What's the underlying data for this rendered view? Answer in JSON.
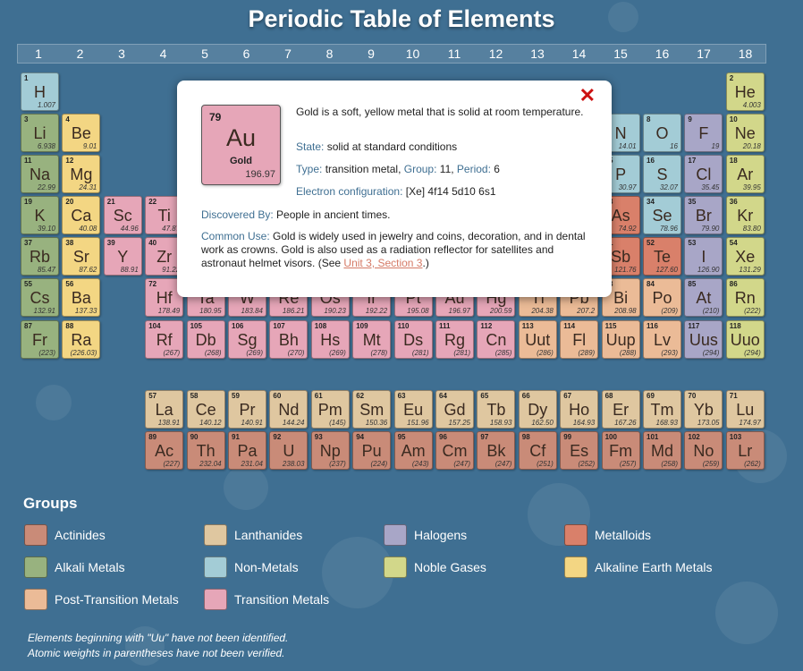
{
  "title": "Periodic Table of Elements",
  "group_numbers": [
    "1",
    "2",
    "3",
    "4",
    "5",
    "6",
    "7",
    "8",
    "9",
    "10",
    "11",
    "12",
    "13",
    "14",
    "15",
    "16",
    "17",
    "18"
  ],
  "category_colors": {
    "actinide": "#c98b78",
    "lanthanide": "#dfc7a0",
    "halogen": "#a8a6c7",
    "metalloid": "#d9806a",
    "alkali": "#98b27f",
    "nonmetal": "#a3ccd6",
    "noble": "#d2d78a",
    "alkearth": "#f3d683",
    "posttrans": "#ebbb97",
    "trans": "#e6a6b8"
  },
  "elements": [
    {
      "n": "1",
      "s": "H",
      "w": "1.007",
      "cat": "nonmetal",
      "period": 1,
      "group": 1
    },
    {
      "n": "2",
      "s": "He",
      "w": "4.003",
      "cat": "noble",
      "period": 1,
      "group": 18
    },
    {
      "n": "3",
      "s": "Li",
      "w": "6.938",
      "cat": "alkali",
      "period": 2,
      "group": 1
    },
    {
      "n": "4",
      "s": "Be",
      "w": "9.01",
      "cat": "alkearth",
      "period": 2,
      "group": 2
    },
    {
      "n": "7",
      "s": "N",
      "w": "14.01",
      "cat": "nonmetal",
      "period": 2,
      "group": 15
    },
    {
      "n": "8",
      "s": "O",
      "w": "16",
      "cat": "nonmetal",
      "period": 2,
      "group": 16
    },
    {
      "n": "9",
      "s": "F",
      "w": "19",
      "cat": "halogen",
      "period": 2,
      "group": 17
    },
    {
      "n": "10",
      "s": "Ne",
      "w": "20.18",
      "cat": "noble",
      "period": 2,
      "group": 18
    },
    {
      "n": "11",
      "s": "Na",
      "w": "22.99",
      "cat": "alkali",
      "period": 3,
      "group": 1
    },
    {
      "n": "12",
      "s": "Mg",
      "w": "24.31",
      "cat": "alkearth",
      "period": 3,
      "group": 2
    },
    {
      "n": "15",
      "s": "P",
      "w": "30.97",
      "cat": "nonmetal",
      "period": 3,
      "group": 15
    },
    {
      "n": "16",
      "s": "S",
      "w": "32.07",
      "cat": "nonmetal",
      "period": 3,
      "group": 16
    },
    {
      "n": "17",
      "s": "Cl",
      "w": "35.45",
      "cat": "halogen",
      "period": 3,
      "group": 17
    },
    {
      "n": "18",
      "s": "Ar",
      "w": "39.95",
      "cat": "noble",
      "period": 3,
      "group": 18
    },
    {
      "n": "19",
      "s": "K",
      "w": "39.10",
      "cat": "alkali",
      "period": 4,
      "group": 1
    },
    {
      "n": "20",
      "s": "Ca",
      "w": "40.08",
      "cat": "alkearth",
      "period": 4,
      "group": 2
    },
    {
      "n": "21",
      "s": "Sc",
      "w": "44.96",
      "cat": "trans",
      "period": 4,
      "group": 3
    },
    {
      "n": "22",
      "s": "Ti",
      "w": "47.87",
      "cat": "trans",
      "period": 4,
      "group": 4
    },
    {
      "n": "33",
      "s": "As",
      "w": "74.92",
      "cat": "metalloid",
      "period": 4,
      "group": 15
    },
    {
      "n": "34",
      "s": "Se",
      "w": "78.96",
      "cat": "nonmetal",
      "period": 4,
      "group": 16
    },
    {
      "n": "35",
      "s": "Br",
      "w": "79.90",
      "cat": "halogen",
      "period": 4,
      "group": 17
    },
    {
      "n": "36",
      "s": "Kr",
      "w": "83.80",
      "cat": "noble",
      "period": 4,
      "group": 18
    },
    {
      "n": "37",
      "s": "Rb",
      "w": "85.47",
      "cat": "alkali",
      "period": 5,
      "group": 1
    },
    {
      "n": "38",
      "s": "Sr",
      "w": "87.62",
      "cat": "alkearth",
      "period": 5,
      "group": 2
    },
    {
      "n": "39",
      "s": "Y",
      "w": "88.91",
      "cat": "trans",
      "period": 5,
      "group": 3
    },
    {
      "n": "40",
      "s": "Zr",
      "w": "91.22",
      "cat": "trans",
      "period": 5,
      "group": 4
    },
    {
      "n": "51",
      "s": "Sb",
      "w": "121.76",
      "cat": "metalloid",
      "period": 5,
      "group": 15
    },
    {
      "n": "52",
      "s": "Te",
      "w": "127.60",
      "cat": "metalloid",
      "period": 5,
      "group": 16
    },
    {
      "n": "53",
      "s": "I",
      "w": "126.90",
      "cat": "halogen",
      "period": 5,
      "group": 17
    },
    {
      "n": "54",
      "s": "Xe",
      "w": "131.29",
      "cat": "noble",
      "period": 5,
      "group": 18
    },
    {
      "n": "55",
      "s": "Cs",
      "w": "132.91",
      "cat": "alkali",
      "period": 6,
      "group": 1
    },
    {
      "n": "56",
      "s": "Ba",
      "w": "137.33",
      "cat": "alkearth",
      "period": 6,
      "group": 2
    },
    {
      "n": "72",
      "s": "Hf",
      "w": "178.49",
      "cat": "trans",
      "period": 6,
      "group": 4
    },
    {
      "n": "73",
      "s": "Ta",
      "w": "180.95",
      "cat": "trans",
      "period": 6,
      "group": 5
    },
    {
      "n": "74",
      "s": "W",
      "w": "183.84",
      "cat": "trans",
      "period": 6,
      "group": 6
    },
    {
      "n": "75",
      "s": "Re",
      "w": "186.21",
      "cat": "trans",
      "period": 6,
      "group": 7
    },
    {
      "n": "76",
      "s": "Os",
      "w": "190.23",
      "cat": "trans",
      "period": 6,
      "group": 8
    },
    {
      "n": "77",
      "s": "Ir",
      "w": "192.22",
      "cat": "trans",
      "period": 6,
      "group": 9
    },
    {
      "n": "78",
      "s": "Pt",
      "w": "195.08",
      "cat": "trans",
      "period": 6,
      "group": 10
    },
    {
      "n": "79",
      "s": "Au",
      "w": "196.97",
      "cat": "trans",
      "period": 6,
      "group": 11
    },
    {
      "n": "80",
      "s": "Hg",
      "w": "200.59",
      "cat": "trans",
      "period": 6,
      "group": 12
    },
    {
      "n": "81",
      "s": "Tl",
      "w": "204.38",
      "cat": "posttrans",
      "period": 6,
      "group": 13
    },
    {
      "n": "82",
      "s": "Pb",
      "w": "207.2",
      "cat": "posttrans",
      "period": 6,
      "group": 14
    },
    {
      "n": "83",
      "s": "Bi",
      "w": "208.98",
      "cat": "posttrans",
      "period": 6,
      "group": 15
    },
    {
      "n": "84",
      "s": "Po",
      "w": "(209)",
      "cat": "posttrans",
      "period": 6,
      "group": 16
    },
    {
      "n": "85",
      "s": "At",
      "w": "(210)",
      "cat": "halogen",
      "period": 6,
      "group": 17
    },
    {
      "n": "86",
      "s": "Rn",
      "w": "(222)",
      "cat": "noble",
      "period": 6,
      "group": 18
    },
    {
      "n": "87",
      "s": "Fr",
      "w": "(223)",
      "cat": "alkali",
      "period": 7,
      "group": 1
    },
    {
      "n": "88",
      "s": "Ra",
      "w": "(226.03)",
      "cat": "alkearth",
      "period": 7,
      "group": 2
    },
    {
      "n": "104",
      "s": "Rf",
      "w": "(267)",
      "cat": "trans",
      "period": 7,
      "group": 4
    },
    {
      "n": "105",
      "s": "Db",
      "w": "(268)",
      "cat": "trans",
      "period": 7,
      "group": 5
    },
    {
      "n": "106",
      "s": "Sg",
      "w": "(269)",
      "cat": "trans",
      "period": 7,
      "group": 6
    },
    {
      "n": "107",
      "s": "Bh",
      "w": "(270)",
      "cat": "trans",
      "period": 7,
      "group": 7
    },
    {
      "n": "108",
      "s": "Hs",
      "w": "(269)",
      "cat": "trans",
      "period": 7,
      "group": 8
    },
    {
      "n": "109",
      "s": "Mt",
      "w": "(278)",
      "cat": "trans",
      "period": 7,
      "group": 9
    },
    {
      "n": "110",
      "s": "Ds",
      "w": "(281)",
      "cat": "trans",
      "period": 7,
      "group": 10
    },
    {
      "n": "111",
      "s": "Rg",
      "w": "(281)",
      "cat": "trans",
      "period": 7,
      "group": 11
    },
    {
      "n": "112",
      "s": "Cn",
      "w": "(285)",
      "cat": "trans",
      "period": 7,
      "group": 12
    },
    {
      "n": "113",
      "s": "Uut",
      "w": "(286)",
      "cat": "posttrans",
      "period": 7,
      "group": 13
    },
    {
      "n": "114",
      "s": "Fl",
      "w": "(289)",
      "cat": "posttrans",
      "period": 7,
      "group": 14
    },
    {
      "n": "115",
      "s": "Uup",
      "w": "(288)",
      "cat": "posttrans",
      "period": 7,
      "group": 15
    },
    {
      "n": "116",
      "s": "Lv",
      "w": "(293)",
      "cat": "posttrans",
      "period": 7,
      "group": 16
    },
    {
      "n": "117",
      "s": "Uus",
      "w": "(294)",
      "cat": "halogen",
      "period": 7,
      "group": 17
    },
    {
      "n": "118",
      "s": "Uuo",
      "w": "(294)",
      "cat": "noble",
      "period": 7,
      "group": 18
    },
    {
      "n": "57",
      "s": "La",
      "w": "138.91",
      "cat": "lanthanide",
      "period": 8,
      "group": 4
    },
    {
      "n": "58",
      "s": "Ce",
      "w": "140.12",
      "cat": "lanthanide",
      "period": 8,
      "group": 5
    },
    {
      "n": "59",
      "s": "Pr",
      "w": "140.91",
      "cat": "lanthanide",
      "period": 8,
      "group": 6
    },
    {
      "n": "60",
      "s": "Nd",
      "w": "144.24",
      "cat": "lanthanide",
      "period": 8,
      "group": 7
    },
    {
      "n": "61",
      "s": "Pm",
      "w": "(145)",
      "cat": "lanthanide",
      "period": 8,
      "group": 8
    },
    {
      "n": "62",
      "s": "Sm",
      "w": "150.36",
      "cat": "lanthanide",
      "period": 8,
      "group": 9
    },
    {
      "n": "63",
      "s": "Eu",
      "w": "151.96",
      "cat": "lanthanide",
      "period": 8,
      "group": 10
    },
    {
      "n": "64",
      "s": "Gd",
      "w": "157.25",
      "cat": "lanthanide",
      "period": 8,
      "group": 11
    },
    {
      "n": "65",
      "s": "Tb",
      "w": "158.93",
      "cat": "lanthanide",
      "period": 8,
      "group": 12
    },
    {
      "n": "66",
      "s": "Dy",
      "w": "162.50",
      "cat": "lanthanide",
      "period": 8,
      "group": 13
    },
    {
      "n": "67",
      "s": "Ho",
      "w": "164.93",
      "cat": "lanthanide",
      "period": 8,
      "group": 14
    },
    {
      "n": "68",
      "s": "Er",
      "w": "167.26",
      "cat": "lanthanide",
      "period": 8,
      "group": 15
    },
    {
      "n": "69",
      "s": "Tm",
      "w": "168.93",
      "cat": "lanthanide",
      "period": 8,
      "group": 16
    },
    {
      "n": "70",
      "s": "Yb",
      "w": "173.05",
      "cat": "lanthanide",
      "period": 8,
      "group": 17
    },
    {
      "n": "71",
      "s": "Lu",
      "w": "174.97",
      "cat": "lanthanide",
      "period": 8,
      "group": 18
    },
    {
      "n": "89",
      "s": "Ac",
      "w": "(227)",
      "cat": "actinide",
      "period": 9,
      "group": 4
    },
    {
      "n": "90",
      "s": "Th",
      "w": "232.04",
      "cat": "actinide",
      "period": 9,
      "group": 5
    },
    {
      "n": "91",
      "s": "Pa",
      "w": "231.04",
      "cat": "actinide",
      "period": 9,
      "group": 6
    },
    {
      "n": "92",
      "s": "U",
      "w": "238.03",
      "cat": "actinide",
      "period": 9,
      "group": 7
    },
    {
      "n": "93",
      "s": "Np",
      "w": "(237)",
      "cat": "actinide",
      "period": 9,
      "group": 8
    },
    {
      "n": "94",
      "s": "Pu",
      "w": "(224)",
      "cat": "actinide",
      "period": 9,
      "group": 9
    },
    {
      "n": "95",
      "s": "Am",
      "w": "(243)",
      "cat": "actinide",
      "period": 9,
      "group": 10
    },
    {
      "n": "96",
      "s": "Cm",
      "w": "(247)",
      "cat": "actinide",
      "period": 9,
      "group": 11
    },
    {
      "n": "97",
      "s": "Bk",
      "w": "(247)",
      "cat": "actinide",
      "period": 9,
      "group": 12
    },
    {
      "n": "98",
      "s": "Cf",
      "w": "(251)",
      "cat": "actinide",
      "period": 9,
      "group": 13
    },
    {
      "n": "99",
      "s": "Es",
      "w": "(252)",
      "cat": "actinide",
      "period": 9,
      "group": 14
    },
    {
      "n": "100",
      "s": "Fm",
      "w": "(257)",
      "cat": "actinide",
      "period": 9,
      "group": 15
    },
    {
      "n": "101",
      "s": "Md",
      "w": "(258)",
      "cat": "actinide",
      "period": 9,
      "group": 16
    },
    {
      "n": "102",
      "s": "No",
      "w": "(259)",
      "cat": "actinide",
      "period": 9,
      "group": 17
    },
    {
      "n": "103",
      "s": "Lr",
      "w": "(262)",
      "cat": "actinide",
      "period": 9,
      "group": 18
    }
  ],
  "popup": {
    "close_label": "✕",
    "number": "79",
    "symbol": "Au",
    "name": "Gold",
    "weight": "196.97",
    "description": "Gold is a soft, yellow metal that is solid at room temperature.",
    "state_label": "State:",
    "state_value": "solid at standard conditions",
    "type_label": "Type:",
    "type_value": "transition metal,",
    "group_label": "Group:",
    "group_value": "11,",
    "period_label": "Period:",
    "period_value": "6",
    "config_label": "Electron configuration:",
    "config_value": "[Xe] 4f14 5d10 6s1",
    "discovered_label": "Discovered By:",
    "discovered_value": "People in ancient times.",
    "use_label": "Common Use:",
    "use_value": "Gold is widely used in jewelry and coins, decoration, and in dental work as crowns. Gold is also used as a radiation reflector for satellites and astronaut helmet visors. (See",
    "use_link": "Unit 3, Section 3",
    "use_end": ".)"
  },
  "groups_title": "Groups",
  "legend": [
    {
      "label": "Actinides",
      "cat": "actinide"
    },
    {
      "label": "Lanthanides",
      "cat": "lanthanide"
    },
    {
      "label": "Halogens",
      "cat": "halogen"
    },
    {
      "label": "Metalloids",
      "cat": "metalloid"
    },
    {
      "label": "Alkali Metals",
      "cat": "alkali"
    },
    {
      "label": "Non-Metals",
      "cat": "nonmetal"
    },
    {
      "label": "Noble Gases",
      "cat": "noble"
    },
    {
      "label": "Alkaline Earth Metals",
      "cat": "alkearth"
    },
    {
      "label": "Post-Transition Metals",
      "cat": "posttrans"
    },
    {
      "label": "Transition Metals",
      "cat": "trans"
    }
  ],
  "notes": [
    "Elements beginning with \"Uu\" have not been identified.",
    "Atomic weights in parentheses have not been verified."
  ]
}
